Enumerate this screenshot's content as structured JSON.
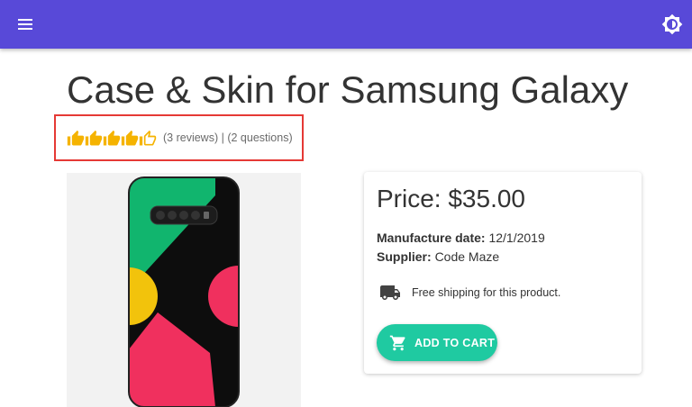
{
  "colors": {
    "appbar": "#5849d8",
    "accent": "#1fcaa1",
    "rating": "#f5b300",
    "highlight_border": "#e53935"
  },
  "appbar": {
    "menu_icon": "menu-icon",
    "theme_icon": "brightness-icon"
  },
  "product": {
    "title": "Case & Skin for Samsung Galaxy",
    "rating": {
      "value": 4.5,
      "max": 5,
      "icon": "thumbs-up-icon"
    },
    "reviews_label": "(3 reviews)",
    "separator": "|",
    "questions_label": "(2 questions)",
    "image_icon": "phone-case-image"
  },
  "details": {
    "price": "Price: $35.00",
    "manufacture_label": "Manufacture date:",
    "manufacture_value": "12/1/2019",
    "supplier_label": "Supplier:",
    "supplier_value": "Code Maze",
    "shipping_icon": "truck-icon",
    "shipping_text": "Free shipping for this product.",
    "cart_icon": "cart-icon",
    "add_to_cart_label": "ADD TO CART"
  }
}
